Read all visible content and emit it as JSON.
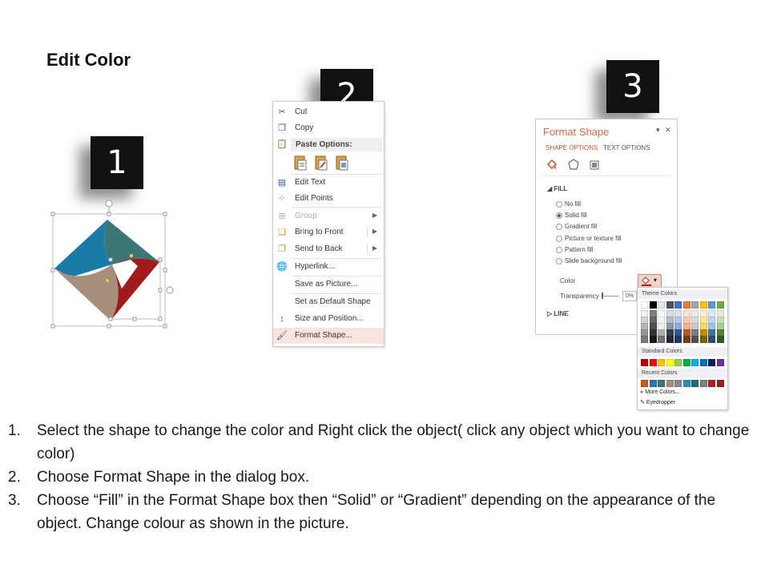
{
  "page": {
    "title": "Edit Color"
  },
  "steps": {
    "one": "1",
    "two": "2",
    "three": "3"
  },
  "context_menu": {
    "items": [
      {
        "label": "Cut",
        "icon": "scissors-icon"
      },
      {
        "label": "Copy",
        "icon": "copy-icon"
      },
      {
        "label": "Paste Options:",
        "icon": "paste-icon"
      },
      {
        "label": "Edit Text",
        "icon": "edit-text-icon"
      },
      {
        "label": "Edit Points",
        "icon": "edit-points-icon"
      },
      {
        "label": "Group",
        "icon": "group-icon"
      },
      {
        "label": "Bring to Front",
        "icon": "bring-front-icon"
      },
      {
        "label": "Send to Back",
        "icon": "send-back-icon"
      },
      {
        "label": "Hyperlink...",
        "icon": "hyperlink-icon"
      },
      {
        "label": "Save as Picture...",
        "icon": ""
      },
      {
        "label": "Set as Default Shape",
        "icon": ""
      },
      {
        "label": "Size and Position...",
        "icon": "size-position-icon"
      },
      {
        "label": "Format Shape...",
        "icon": "format-shape-icon"
      }
    ]
  },
  "format_pane": {
    "title": "Format Shape",
    "tabs": {
      "shape_options": "SHAPE OPTIONS",
      "text_options": "TEXT OPTIONS"
    },
    "fill_section": "FILL",
    "fill_options": {
      "no_fill": "No fill",
      "solid_fill": "Solid fill",
      "gradient_fill": "Gradient fill",
      "picture_fill": "Picture or texture fill",
      "pattern_fill": "Pattern fill",
      "slide_bg_fill": "Slide background fill"
    },
    "color_label": "Color",
    "transparency_label": "Transparency",
    "transparency_value": "0%",
    "line_section": "LINE"
  },
  "color_picker": {
    "theme_label": "Theme Colors",
    "standard_label": "Standard Colors",
    "recent_label": "Recent Colors",
    "more_colors": "More Colors...",
    "eyedropper": "Eyedropper",
    "theme_top": [
      "#ffffff",
      "#000000",
      "#e7e6e6",
      "#44546a",
      "#4472c4",
      "#ed7d31",
      "#a5a5a5",
      "#ffc000",
      "#5b9bd5",
      "#70ad47"
    ],
    "standard": [
      "#c00000",
      "#ff0000",
      "#ffc000",
      "#ffff00",
      "#92d050",
      "#00b050",
      "#00b0f0",
      "#0070c0",
      "#002060",
      "#7030a0"
    ],
    "recent": [
      "#c55a11",
      "#2e75b6",
      "#3a7a7a",
      "#a68d7b",
      "#8b8b8b",
      "#2b8fb0",
      "#1f6f7a",
      "#7f7f7f",
      "#b22222",
      "#a61c1c"
    ]
  },
  "shape_colors": {
    "blue": "#1a7aa8",
    "teal": "#3d7676",
    "red": "#a31a1a",
    "tan": "#a88e7d"
  },
  "instructions": [
    {
      "num": "1.",
      "text": "Select the shape to change the color and Right click the object( click any object which you want to change color)"
    },
    {
      "num": "2.",
      "text": "Choose Format Shape in the dialog box."
    },
    {
      "num": "3.",
      "text": "Choose “Fill” in the Format Shape box then “Solid” or “Gradient” depending on the appearance of the object. Change colour as shown in the picture."
    }
  ]
}
